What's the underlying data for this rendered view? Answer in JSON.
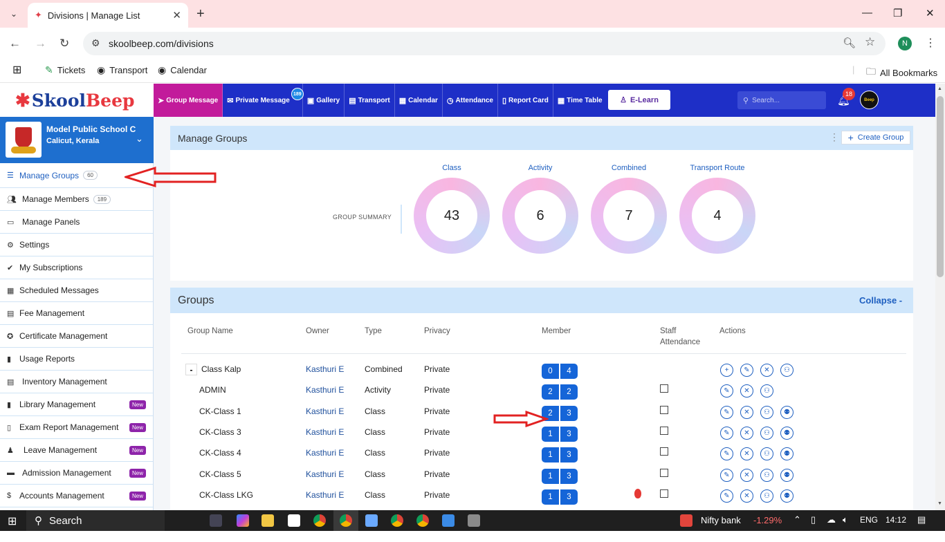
{
  "browser": {
    "tab_title": "Divisions | Manage List",
    "url": "skoolbeep.com/divisions",
    "profile_initial": "N",
    "bookmarks": [
      {
        "label": "Tickets",
        "icon": "ticket-icon"
      },
      {
        "label": "Transport",
        "icon": "globe-icon"
      },
      {
        "label": "Calendar",
        "icon": "globe-icon"
      }
    ],
    "all_bookmarks": "All Bookmarks"
  },
  "app": {
    "logo": "SkoolBeep",
    "nav": [
      {
        "label": "Group Message",
        "icon": "send-icon"
      },
      {
        "label": "Private Message",
        "icon": "mail-icon",
        "badge": "189"
      },
      {
        "label": "Gallery",
        "icon": "image-icon"
      },
      {
        "label": "Transport",
        "icon": "bus-icon"
      },
      {
        "label": "Calendar",
        "icon": "calendar-icon"
      },
      {
        "label": "Attendance",
        "icon": "clock-icon"
      },
      {
        "label": "Report Card",
        "icon": "file-icon"
      },
      {
        "label": "Time Table",
        "icon": "calendar-icon"
      }
    ],
    "elearn": "E-Learn",
    "search_placeholder": "Search...",
    "notification_count": "18",
    "avatar_text": "Beep"
  },
  "school": {
    "name": "Model Public School C",
    "location": "Calicut, Kerala"
  },
  "sidebar": {
    "items": [
      {
        "label": "Manage Groups",
        "count": "60",
        "icon": "list-icon",
        "active": true
      },
      {
        "label": "Manage Members",
        "count": "189",
        "icon": "users-icon"
      },
      {
        "label": "Manage Panels",
        "icon": "monitor-icon"
      },
      {
        "label": "Settings",
        "icon": "gear-icon"
      },
      {
        "label": "My Subscriptions",
        "icon": "check-icon"
      },
      {
        "label": "Scheduled Messages",
        "icon": "calendar-icon"
      },
      {
        "label": "Fee Management",
        "icon": "file-icon"
      },
      {
        "label": "Certificate Management",
        "icon": "award-icon"
      },
      {
        "label": "Usage Reports",
        "icon": "bar-chart-icon"
      },
      {
        "label": "Inventory Management",
        "icon": "list-icon"
      },
      {
        "label": "Library Management",
        "icon": "book-icon",
        "new": "New"
      },
      {
        "label": "Exam Report Management",
        "icon": "file-icon",
        "new": "New"
      },
      {
        "label": "Leave Management",
        "icon": "user-minus-icon",
        "new": "New"
      },
      {
        "label": "Admission Management",
        "icon": "id-card-icon",
        "new": "New"
      },
      {
        "label": "Accounts Management",
        "icon": "dollar-icon",
        "new": "New"
      }
    ]
  },
  "manage_groups": {
    "title": "Manage Groups",
    "create_button": "Create Group",
    "summary_label": "GROUP SUMMARY",
    "summary": [
      {
        "label": "Class",
        "value": "43"
      },
      {
        "label": "Activity",
        "value": "6"
      },
      {
        "label": "Combined",
        "value": "7"
      },
      {
        "label": "Transport Route",
        "value": "4"
      }
    ]
  },
  "groups": {
    "title": "Groups",
    "collapse": "Collapse -",
    "columns": [
      "Group Name",
      "Owner",
      "Type",
      "Privacy",
      "Member",
      "Staff",
      "Attendance",
      "Actions"
    ],
    "rows": [
      {
        "name": "Class Kalp",
        "owner": "Kasthuri E",
        "type": "Combined",
        "privacy": "Private",
        "m1": "0",
        "m2": "4"
      },
      {
        "name": "ADMIN",
        "owner": "Kasthuri E",
        "type": "Activity",
        "privacy": "Private",
        "m1": "2",
        "m2": "2"
      },
      {
        "name": "CK-Class 1",
        "owner": "Kasthuri E",
        "type": "Class",
        "privacy": "Private",
        "m1": "2",
        "m2": "3"
      },
      {
        "name": "CK-Class 3",
        "owner": "Kasthuri E",
        "type": "Class",
        "privacy": "Private",
        "m1": "1",
        "m2": "3"
      },
      {
        "name": "CK-Class 4",
        "owner": "Kasthuri E",
        "type": "Class",
        "privacy": "Private",
        "m1": "1",
        "m2": "3"
      },
      {
        "name": "CK-Class 5",
        "owner": "Kasthuri E",
        "type": "Class",
        "privacy": "Private",
        "m1": "1",
        "m2": "3"
      },
      {
        "name": "CK-Class LKG",
        "owner": "Kasthuri E",
        "type": "Class",
        "privacy": "Private",
        "m1": "1",
        "m2": "3"
      }
    ]
  },
  "taskbar": {
    "search": "Search",
    "stock_name": "Nifty bank",
    "stock_change": "-1.29%",
    "lang": "ENG",
    "time": "14:12"
  }
}
